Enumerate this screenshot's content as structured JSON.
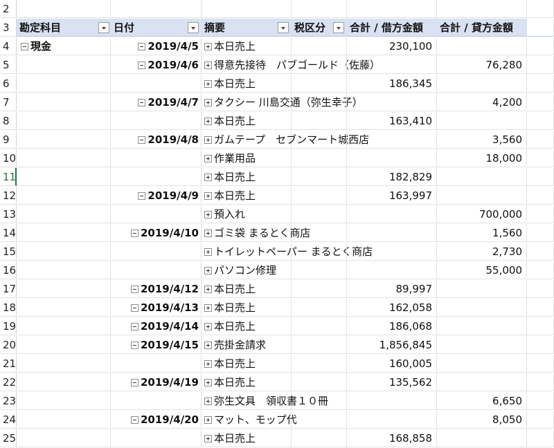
{
  "header": {
    "row_num": "3",
    "col1": "勘定科目",
    "col2": "日付",
    "col3": "摘要",
    "col4": "税区分",
    "col5": "合計 / 借方金額",
    "col6": "合計 / 貸方金額"
  },
  "rows": [
    {
      "n": "2",
      "acct": "",
      "date": "",
      "desc": "",
      "debit": "",
      "credit": ""
    },
    {
      "n": "4",
      "acct": "現金",
      "date": "2019/4/5",
      "desc": "本日売上",
      "debit": "230,100",
      "credit": ""
    },
    {
      "n": "5",
      "acct": "",
      "date": "2019/4/6",
      "desc": "得意先接待　パブゴールド（佐藤）",
      "debit": "",
      "credit": "76,280"
    },
    {
      "n": "6",
      "acct": "",
      "date": "",
      "desc": "本日売上",
      "debit": "186,345",
      "credit": ""
    },
    {
      "n": "7",
      "acct": "",
      "date": "2019/4/7",
      "desc": "タクシー 川島交通（弥生幸子）",
      "debit": "",
      "credit": "4,200"
    },
    {
      "n": "8",
      "acct": "",
      "date": "",
      "desc": "本日売上",
      "debit": "163,410",
      "credit": ""
    },
    {
      "n": "9",
      "acct": "",
      "date": "2019/4/8",
      "desc": "ガムテープ　セブンマート城西店",
      "debit": "",
      "credit": "3,560"
    },
    {
      "n": "10",
      "acct": "",
      "date": "",
      "desc": "作業用品",
      "debit": "",
      "credit": "18,000"
    },
    {
      "n": "11",
      "acct": "",
      "date": "",
      "desc": "本日売上",
      "debit": "182,829",
      "credit": ""
    },
    {
      "n": "12",
      "acct": "",
      "date": "2019/4/9",
      "desc": "本日売上",
      "debit": "163,997",
      "credit": ""
    },
    {
      "n": "13",
      "acct": "",
      "date": "",
      "desc": "預入れ",
      "debit": "",
      "credit": "700,000"
    },
    {
      "n": "14",
      "acct": "",
      "date": "2019/4/10",
      "desc": "ゴミ袋 まるとく商店",
      "debit": "",
      "credit": "1,560"
    },
    {
      "n": "15",
      "acct": "",
      "date": "",
      "desc": "トイレットペーパー まるとく商店",
      "debit": "",
      "credit": "2,730"
    },
    {
      "n": "16",
      "acct": "",
      "date": "",
      "desc": "パソコン修理",
      "debit": "",
      "credit": "55,000"
    },
    {
      "n": "17",
      "acct": "",
      "date": "2019/4/12",
      "desc": "本日売上",
      "debit": "89,997",
      "credit": ""
    },
    {
      "n": "18",
      "acct": "",
      "date": "2019/4/13",
      "desc": "本日売上",
      "debit": "162,058",
      "credit": ""
    },
    {
      "n": "19",
      "acct": "",
      "date": "2019/4/14",
      "desc": "本日売上",
      "debit": "186,068",
      "credit": ""
    },
    {
      "n": "20",
      "acct": "",
      "date": "2019/4/15",
      "desc": "売掛金請求",
      "debit": "1,856,845",
      "credit": ""
    },
    {
      "n": "21",
      "acct": "",
      "date": "",
      "desc": "本日売上",
      "debit": "160,005",
      "credit": ""
    },
    {
      "n": "22",
      "acct": "",
      "date": "2019/4/19",
      "desc": "本日売上",
      "debit": "135,562",
      "credit": ""
    },
    {
      "n": "23",
      "acct": "",
      "date": "",
      "desc": "弥生文具　領収書１０冊",
      "debit": "",
      "credit": "6,650"
    },
    {
      "n": "24",
      "acct": "",
      "date": "2019/4/20",
      "desc": "マット、モップ代",
      "debit": "",
      "credit": "8,050"
    },
    {
      "n": "25",
      "acct": "",
      "date": "",
      "desc": "本日売上",
      "debit": "168,858",
      "credit": ""
    }
  ],
  "selected_row": "11"
}
